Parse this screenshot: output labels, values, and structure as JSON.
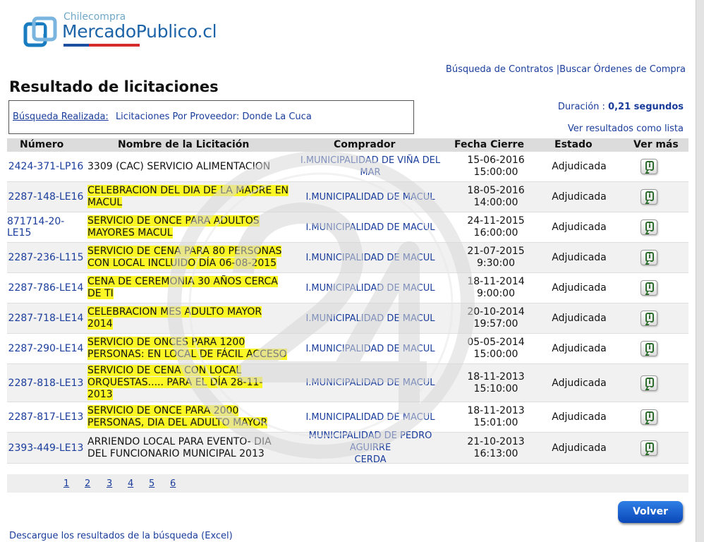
{
  "logo": {
    "small": "Chilecompra",
    "big": "MercadoPublico.cl"
  },
  "top_links": {
    "contracts": "Búsqueda de Contratos",
    "separator": "|",
    "orders": "Buscar Órdenes de Compra"
  },
  "page_title": "Resultado de licitaciones",
  "search": {
    "label": "Búsqueda Realizada:",
    "value": "Licitaciones Por Proveedor: Donde La Cuca"
  },
  "duration": {
    "label": "Duración :",
    "value": "0,21 segundos"
  },
  "view_list": "Ver resultados como lista",
  "columns": [
    "Número",
    "Nombre de la Licitación",
    "Comprador",
    "Fecha Cierre",
    "Estado",
    "Ver más"
  ],
  "rows": [
    {
      "numero": "2424-371-LP16",
      "nombre": [
        "3309 (CAC) SERVICIO ALIMENTACION"
      ],
      "highlight": false,
      "comprador": [
        "I.MUNICIPALIDAD DE VIÑA DEL MAR"
      ],
      "fecha": [
        "15-06-2016",
        "15:00:00"
      ],
      "estado": "Adjudicada"
    },
    {
      "numero": "2287-148-LE16",
      "nombre": [
        " CELEBRACION DEL DIA DE LA MADRE EN",
        "MACUL"
      ],
      "highlight": true,
      "comprador": [
        "I.MUNICIPALIDAD DE MACUL"
      ],
      "fecha": [
        "18-05-2016",
        "14:00:00"
      ],
      "estado": "Adjudicada"
    },
    {
      "numero": "871714-20-LE15",
      "nombre": [
        " SERVICIO DE ONCE PARA ADULTOS",
        "MAYORES MACUL"
      ],
      "highlight": true,
      "comprador": [
        "I.MUNICIPALIDAD DE MACUL"
      ],
      "fecha": [
        "24-11-2015",
        "16:00:00"
      ],
      "estado": "Adjudicada"
    },
    {
      "numero": "2287-236-L115",
      "nombre": [
        " SERVICIO DE CENA PARA 80 PERSONAS",
        "CON LOCAL INCLUIDO DÍA 06-08-2015"
      ],
      "highlight": true,
      "comprador": [
        "I.MUNICIPALIDAD DE MACUL"
      ],
      "fecha": [
        "21-07-2015",
        "9:30:00"
      ],
      "estado": "Adjudicada"
    },
    {
      "numero": "2287-786-LE14",
      "nombre": [
        " CENA DE CEREMONIA 30 AÑOS CERCA",
        "DE TI"
      ],
      "highlight": true,
      "comprador": [
        "I.MUNICIPALIDAD DE MACUL"
      ],
      "fecha": [
        "18-11-2014",
        "9:00:00"
      ],
      "estado": "Adjudicada"
    },
    {
      "numero": "2287-718-LE14",
      "nombre": [
        " CELEBRACION MES ADULTO MAYOR",
        "2014"
      ],
      "highlight": true,
      "comprador": [
        "I.MUNICIPALIDAD DE MACUL"
      ],
      "fecha": [
        "20-10-2014",
        "19:57:00"
      ],
      "estado": "Adjudicada"
    },
    {
      "numero": "2287-290-LE14",
      "nombre": [
        " SERVICIO DE ONCES PARA 1200",
        "PERSONAS: EN LOCAL DE FÁCIL ACCESO"
      ],
      "highlight": true,
      "comprador": [
        "I.MUNICIPALIDAD DE MACUL"
      ],
      "fecha": [
        "05-05-2014",
        "15:00:00"
      ],
      "estado": "Adjudicada"
    },
    {
      "numero": "2287-818-LE13",
      "nombre": [
        " SERVICIO DE CENA CON LOCAL",
        "ORQUESTAS..... PARA EL DÍA 28-11-",
        "2013"
      ],
      "highlight": true,
      "comprador": [
        "I.MUNICIPALIDAD DE MACUL"
      ],
      "fecha": [
        "18-11-2013",
        "15:10:00"
      ],
      "estado": "Adjudicada"
    },
    {
      "numero": "2287-817-LE13",
      "nombre": [
        " SERVICIO DE ONCE PARA 2000",
        "PERSONAS, DIA DEL ADULTO MAYOR"
      ],
      "highlight": true,
      "comprador": [
        "I.MUNICIPALIDAD DE MACUL"
      ],
      "fecha": [
        "18-11-2013",
        "15:01:00"
      ],
      "estado": "Adjudicada"
    },
    {
      "numero": "2393-449-LE13",
      "nombre": [
        " ARRIENDO LOCAL PARA EVENTO- DIA",
        "DEL FUNCIONARIO MUNICIPAL 2013"
      ],
      "highlight": false,
      "comprador": [
        "MUNICIPALIDAD DE PEDRO AGUIRRE",
        "CERDA"
      ],
      "fecha": [
        "21-10-2013",
        "16:13:00"
      ],
      "estado": "Adjudicada"
    }
  ],
  "pages": [
    "1",
    "2",
    "3",
    "4",
    "5",
    "6"
  ],
  "volver": "Volver",
  "excel_link": "Descargue los resultados de la búsqueda (Excel)",
  "colors": {
    "link": "#1a3d9c",
    "highlight": "#fbf724",
    "button": "#0a47b8"
  },
  "icons": {
    "info": "info-speech-bubble-icon"
  }
}
